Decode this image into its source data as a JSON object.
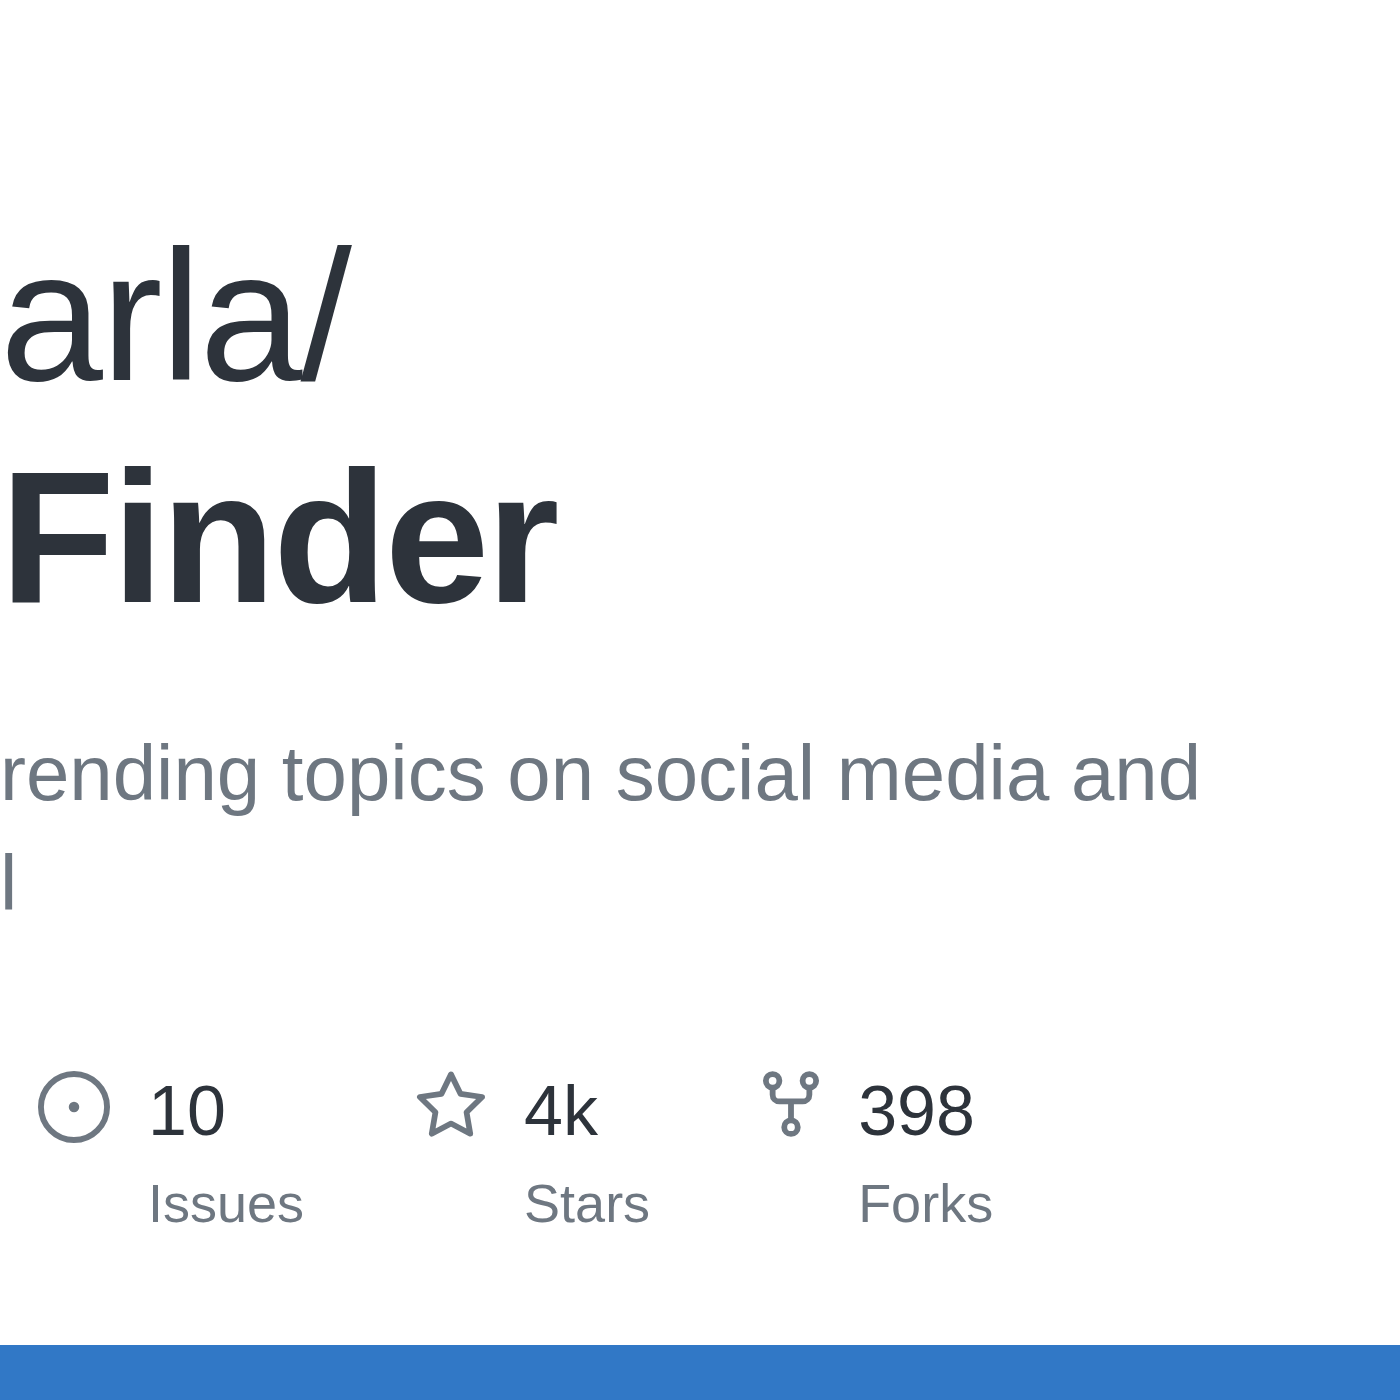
{
  "repository": {
    "owner": "arla/",
    "name": "Finder",
    "description": "rending topics on social media and\nl"
  },
  "stats": [
    {
      "kind": "issues",
      "count": "10",
      "label": "Issues"
    },
    {
      "kind": "stars",
      "count": "4k",
      "label": "Stars"
    },
    {
      "kind": "forks",
      "count": "398",
      "label": "Forks"
    }
  ],
  "language_bar": [
    {
      "color": "#3178c6"
    }
  ]
}
